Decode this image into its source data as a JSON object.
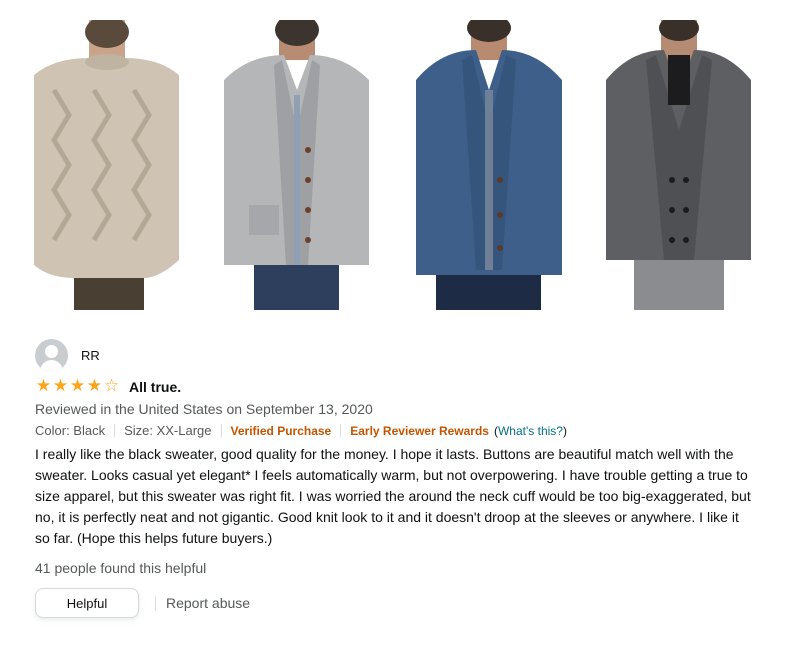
{
  "images": [
    {
      "icon": "beige-cable-knit-sweater-photo"
    },
    {
      "icon": "gray-shawl-cardigan-photo"
    },
    {
      "icon": "blue-shawl-cardigan-photo"
    },
    {
      "icon": "charcoal-shawl-cardigan-photo"
    }
  ],
  "review": {
    "avatar_icon": "default-profile-icon",
    "reviewer": "RR",
    "rating": 4,
    "rating_max": 5,
    "star_color": "#FFA41C",
    "title": "All true.",
    "date": "Reviewed in the United States on September 13, 2020",
    "color": "Color: Black",
    "size": "Size: XX-Large",
    "verified": "Verified Purchase",
    "rewards": "Early Reviewer Rewards",
    "whats_this_open": "(",
    "whats_this": "What's this?",
    "whats_this_close": ")",
    "body": "I really like the black sweater, good quality for the money. I hope it lasts. Buttons are beautiful match well with the sweater. Looks casual yet elegant* I feels automatically warm, but not overpowering. I have trouble getting a true to size apparel, but this sweater was right fit. I was worried the around the neck cuff would be too big-exaggerated, but no, it is perfectly neat and not gigantic. Good knit look to it and it doesn't droop at the sleeves or anywhere. I like it so far. (Hope this helps future buyers.)",
    "helpful_count": "41 people found this helpful",
    "helpful_button": "Helpful",
    "report": "Report abuse"
  },
  "colors": {
    "accent_orange": "#C45500",
    "link_teal": "#007185"
  }
}
